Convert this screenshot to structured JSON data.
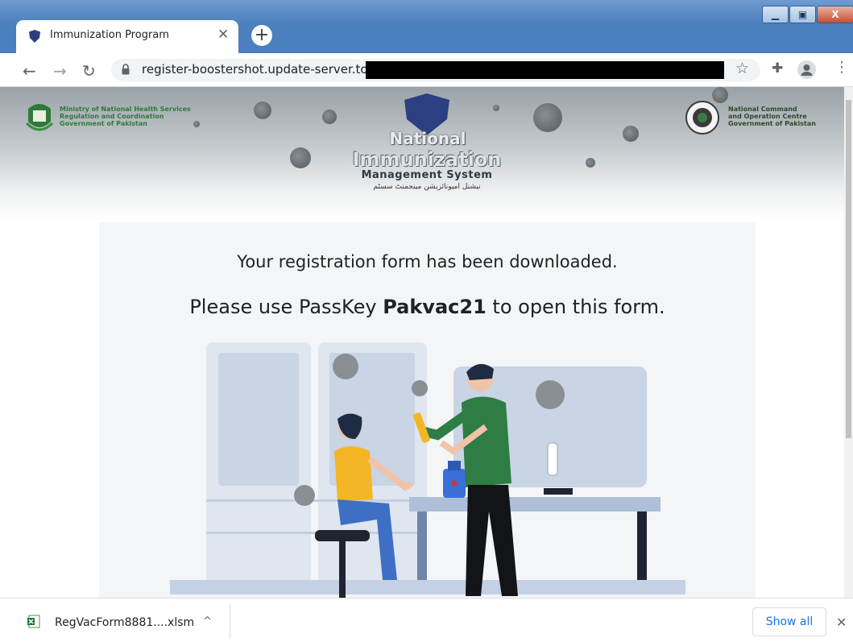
{
  "browser": {
    "tab_title": "Immunization Program",
    "new_tab": "+",
    "url": "register-boostershot.update-server.top",
    "window_buttons": [
      "_",
      "▫",
      "X"
    ]
  },
  "header": {
    "ministry_lines": [
      "Ministry of National Health Services",
      "Regulation and Coordination",
      "Government of Pakistan"
    ],
    "ncoc_lines": [
      "National Command",
      "and Operation Centre",
      "Government of Pakistan"
    ],
    "brand_line1": "National",
    "brand_line2": "Immunization",
    "brand_line3": "Management System",
    "brand_urdu": "نیشنل امیونائزیشن مینجمنٹ سسٹم"
  },
  "main": {
    "message1": "Your registration form has been downloaded.",
    "message2_prefix": "Please use PassKey ",
    "passkey": "Pakvac21",
    "message2_suffix": " to open this form."
  },
  "download_bar": {
    "file_name": "RegVacForm8881....xlsm",
    "show_all": "Show all",
    "close": "✕"
  },
  "colors": {
    "chrome_blue": "#4b7fbd",
    "ministry_green": "#2f7a3a",
    "nurse_green": "#2e7d45",
    "link_blue": "#1a73e8"
  }
}
